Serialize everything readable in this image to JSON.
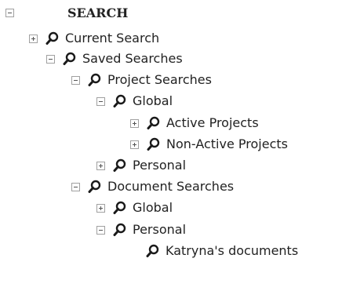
{
  "tree": {
    "root": {
      "label": "SEARCH",
      "expanded": true
    },
    "current_search": {
      "label": "Current Search",
      "expanded": false
    },
    "saved_searches": {
      "label": "Saved Searches",
      "expanded": true
    },
    "project_searches": {
      "label": "Project Searches",
      "expanded": true
    },
    "project_global": {
      "label": "Global",
      "expanded": true
    },
    "active_projects": {
      "label": "Active Projects",
      "expanded": false
    },
    "non_active_projects": {
      "label": "Non-Active Projects",
      "expanded": false
    },
    "project_personal": {
      "label": "Personal",
      "expanded": false
    },
    "document_searches": {
      "label": "Document Searches",
      "expanded": true
    },
    "document_global": {
      "label": "Global",
      "expanded": false
    },
    "document_personal": {
      "label": "Personal",
      "expanded": true
    },
    "katryna_documents": {
      "label": "Katryna's documents"
    }
  },
  "icons": {
    "node": "search-icon",
    "collapse": "minus-toggle",
    "expand": "plus-toggle"
  }
}
